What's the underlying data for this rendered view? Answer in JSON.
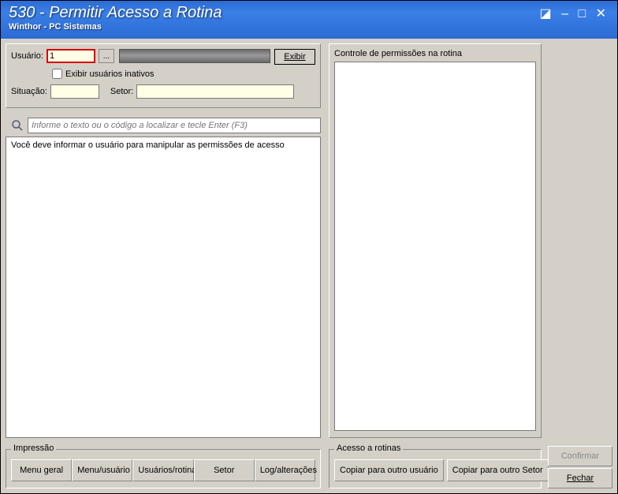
{
  "titlebar": {
    "main": "530 - Permitir Acesso a Rotina",
    "sub": "Winthor - PC Sistemas"
  },
  "form": {
    "usuario_label": "Usuário:",
    "usuario_value": "1",
    "exibir_label": "Exibir",
    "inativos_label": "Exibir usuários inativos",
    "situacao_label": "Situação:",
    "situacao_value": "",
    "setor_label": "Setor:",
    "setor_value": ""
  },
  "search": {
    "placeholder": "Informe o texto ou o código a localizar e tecle Enter (F3)"
  },
  "list": {
    "message": "Você deve informar o usuário para manipular as permissões de acesso"
  },
  "impressao": {
    "legend": "Impressão",
    "menu_geral": "Menu geral",
    "menu_usuario": "Menu/usuário",
    "usuarios_rotina": "Usuários/rotina",
    "setor": "Setor",
    "log": "Log/alterações"
  },
  "controle": {
    "label": "Controle de permissões na rotina"
  },
  "acesso": {
    "legend": "Acesso a rotinas",
    "copiar_usuario": "Copiar para outro usuário",
    "copiar_setor": "Copiar para outro Setor"
  },
  "side": {
    "confirmar": "Confirmar",
    "fechar": "Fechar"
  }
}
